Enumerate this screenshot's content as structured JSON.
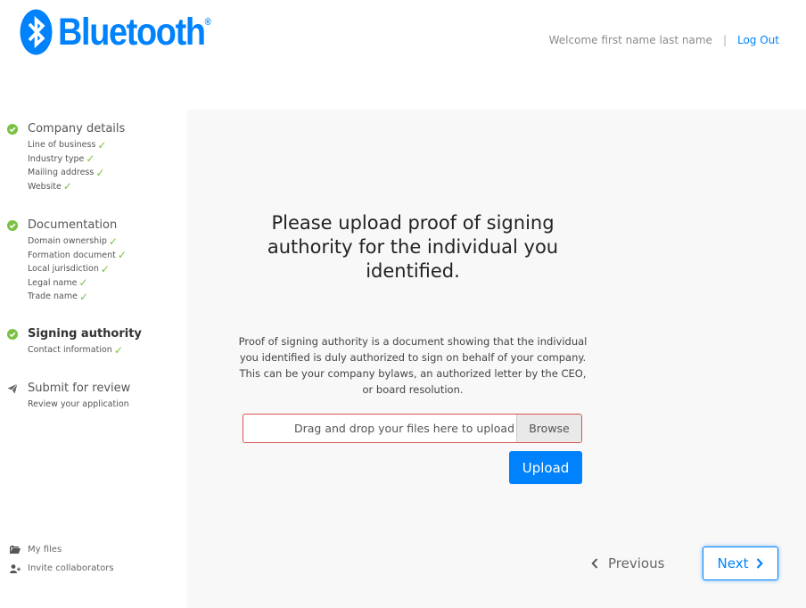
{
  "brand": {
    "name": "Bluetooth",
    "trademark": "®",
    "color": "#0082fc"
  },
  "header": {
    "welcome": "Welcome first name last name",
    "separator": "|",
    "logout": "Log Out"
  },
  "sidebar": {
    "steps": [
      {
        "title": "Company details",
        "status": "complete",
        "substeps": [
          "Line of business",
          "Industry type",
          "Mailing address",
          "Website"
        ]
      },
      {
        "title": "Documentation",
        "status": "complete",
        "substeps": [
          "Domain ownership",
          "Formation document",
          "Local jurisdiction",
          "Legal name",
          "Trade name"
        ]
      },
      {
        "title": "Signing authority",
        "status": "current",
        "substeps": [
          "Contact information"
        ]
      },
      {
        "title": "Submit for review",
        "status": "pending",
        "substeps": [
          "Review your application"
        ]
      }
    ],
    "links": [
      {
        "label": "My files",
        "icon": "folder-icon"
      },
      {
        "label": "Invite collaborators",
        "icon": "add-user-icon"
      }
    ]
  },
  "main": {
    "heading": "Please upload proof of signing authority for the individual you identified.",
    "description": "Proof of signing authority is a document showing that the individual you identified is duly authorized to sign on behalf of your company. This can be your company bylaws, an authorized letter by the CEO, or board resolution.",
    "dropzone_text": "Drag and drop your files here to upload",
    "browse_label": "Browse",
    "upload_label": "Upload",
    "previous_label": "Previous",
    "next_label": "Next"
  },
  "colors": {
    "accent": "#0082fc",
    "success": "#7ac143",
    "error_border": "#d9534f",
    "panel_bg": "#f8f8f8"
  }
}
